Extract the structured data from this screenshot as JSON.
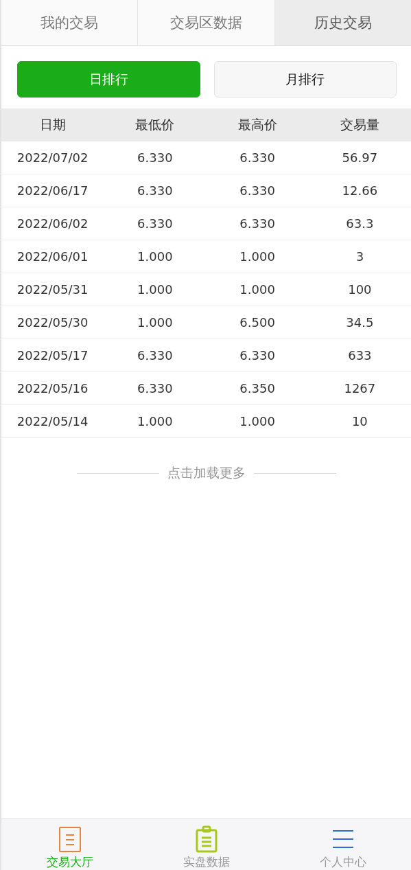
{
  "tabs": [
    {
      "label": "我的交易",
      "selected": false
    },
    {
      "label": "交易区数据",
      "selected": false
    },
    {
      "label": "历史交易",
      "selected": true
    }
  ],
  "ranking_buttons": [
    {
      "label": "日排行",
      "selected": true
    },
    {
      "label": "月排行",
      "selected": false
    }
  ],
  "table": {
    "columns": [
      "日期",
      "最低价",
      "最高价",
      "交易量"
    ],
    "rows": [
      [
        "2022/07/02",
        "6.330",
        "6.330",
        "56.97"
      ],
      [
        "2022/06/17",
        "6.330",
        "6.330",
        "12.66"
      ],
      [
        "2022/06/02",
        "6.330",
        "6.330",
        "63.3"
      ],
      [
        "2022/06/01",
        "1.000",
        "1.000",
        "3"
      ],
      [
        "2022/05/31",
        "1.000",
        "1.000",
        "100"
      ],
      [
        "2022/05/30",
        "1.000",
        "6.500",
        "34.5"
      ],
      [
        "2022/05/17",
        "6.330",
        "6.330",
        "633"
      ],
      [
        "2022/05/16",
        "6.330",
        "6.350",
        "1267"
      ],
      [
        "2022/05/14",
        "1.000",
        "1.000",
        "10"
      ]
    ]
  },
  "load_more": "点击加载更多",
  "bottom_nav": [
    {
      "kind": "document",
      "label": "交易大厅",
      "selected": true,
      "color": "#e8833a"
    },
    {
      "kind": "clipboard",
      "label": "实盘数据",
      "selected": false,
      "color": "#a8c81e"
    },
    {
      "kind": "menu",
      "label": "个人中心",
      "selected": false,
      "color": "#2d6fd0"
    }
  ]
}
